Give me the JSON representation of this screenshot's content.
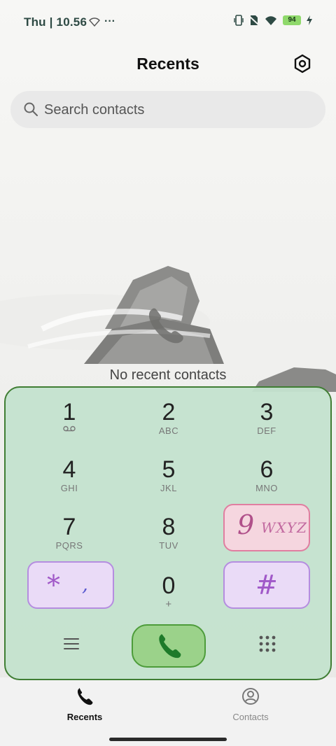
{
  "status_bar": {
    "time": "Thu | 10.56",
    "battery": "94"
  },
  "header": {
    "title": "Recents"
  },
  "search": {
    "placeholder": "Search contacts"
  },
  "empty_state": {
    "text": "No recent contacts"
  },
  "dialpad": {
    "keys": [
      {
        "digit": "1",
        "letters": ""
      },
      {
        "digit": "2",
        "letters": "ABC"
      },
      {
        "digit": "3",
        "letters": "DEF"
      },
      {
        "digit": "4",
        "letters": "GHI"
      },
      {
        "digit": "5",
        "letters": "JKL"
      },
      {
        "digit": "6",
        "letters": "MNO"
      },
      {
        "digit": "7",
        "letters": "PQRS"
      },
      {
        "digit": "8",
        "letters": "TUV"
      },
      {
        "digit": "9",
        "letters": "WXYZ"
      },
      {
        "digit": "*",
        "letters": ","
      },
      {
        "digit": "0",
        "letters": "+"
      },
      {
        "digit": "#",
        "letters": ""
      }
    ]
  },
  "bottom_nav": {
    "items": [
      {
        "label": "Recents",
        "active": true
      },
      {
        "label": "Contacts",
        "active": false
      }
    ]
  },
  "colors": {
    "dialpad_bg": "#c4e2ce",
    "call_button": "#9bd28a",
    "special_key_purple": "#eadbf7",
    "special_key_pink": "#f5d6df"
  }
}
